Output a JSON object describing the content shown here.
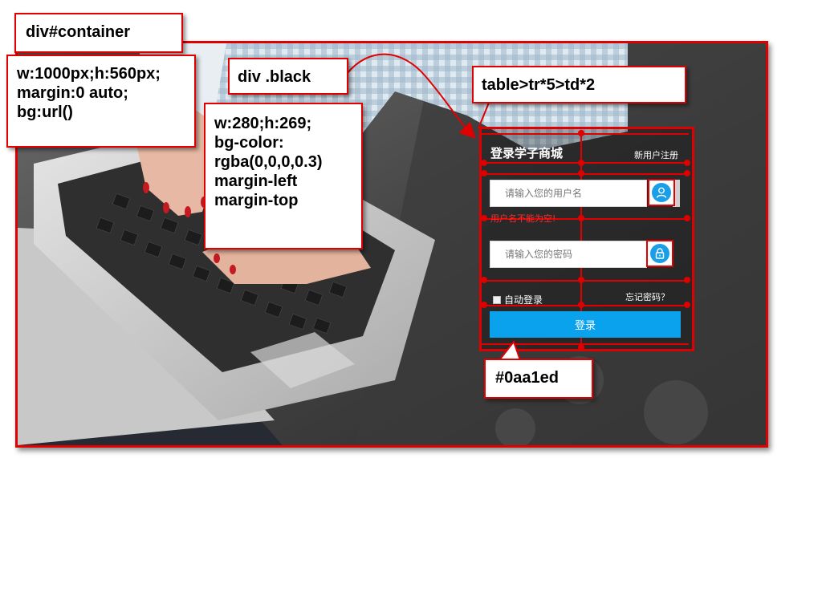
{
  "annotations": {
    "container_title": "div#container",
    "container_props": [
      "w:1000px;h:560px;",
      "margin:0 auto;",
      "bg:url()"
    ],
    "black_title": "div .black",
    "black_props": [
      "w:280;h:269;",
      "bg-color:",
      "rgba(0,0,0,0.3)",
      "margin-left",
      "margin-top"
    ],
    "table_title": "table>tr*5>td*2",
    "color_note": "#0aa1ed"
  },
  "login": {
    "title": "登录学子商城",
    "register_link": "新用户注册",
    "username_placeholder": "请输入您的用户名",
    "username_error": "用户名不能为空!",
    "password_placeholder": "请输入您的密码",
    "remember_label": "自动登录",
    "forgot_link": "忘记密码？",
    "login_button": "登录"
  },
  "icons": {
    "user": "user-icon",
    "lock": "lock-icon"
  },
  "colors": {
    "annotation_border": "#e00000",
    "login_button": "#0aa1ed",
    "icon_circle": "#1b9ee8",
    "panel_overlay": "rgba(0,0,0,0.3)",
    "error_text": "#ff2a2a"
  }
}
